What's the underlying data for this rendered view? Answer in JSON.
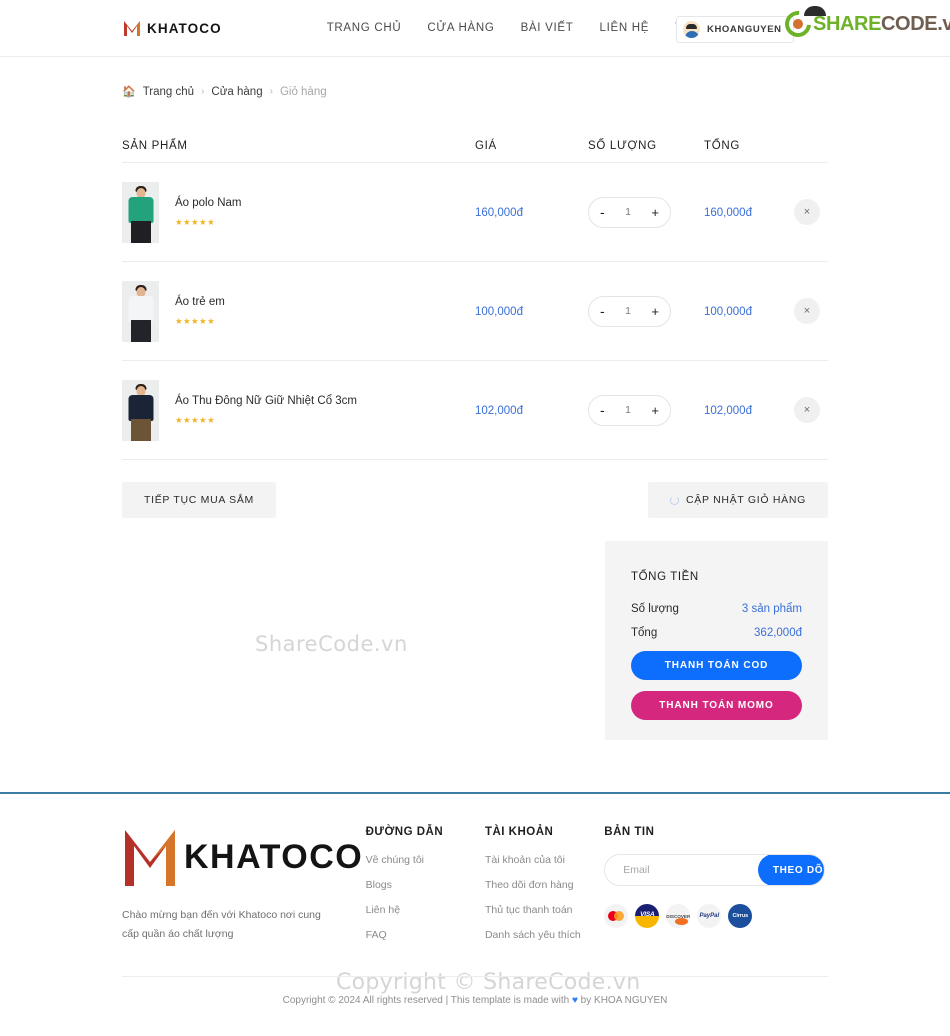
{
  "header": {
    "brand": "KHATOCO",
    "brand_mark_icon": "khatoco-m-monogram-icon",
    "nav": [
      {
        "label": "TRANG CHỦ"
      },
      {
        "label": "CỬA HÀNG"
      },
      {
        "label": "BÀI VIẾT"
      },
      {
        "label": "LIÊN HỆ"
      },
      {
        "label": "TRANG"
      }
    ],
    "user": {
      "name": "KHOANGUYEN",
      "avatar_icon": "user-avatar-icon"
    },
    "watermark_logo": {
      "share": "SHARE",
      "code": "CODE.vn",
      "icon": "sharecode-swirl-icon"
    }
  },
  "breadcrumb": {
    "home_icon": "home-icon",
    "items": [
      {
        "label": "Trang chủ",
        "current": false
      },
      {
        "label": "Cửa hàng",
        "current": false
      },
      {
        "label": "Giỏ hàng",
        "current": true
      }
    ],
    "separator": "›"
  },
  "cart": {
    "columns": {
      "product": "SẢN PHẨM",
      "price": "GIÁ",
      "quantity": "SỐ LƯỢNG",
      "total": "TỔNG"
    },
    "rows": [
      {
        "name": "Áo polo Nam",
        "stars": "★★★★★",
        "price": "160,000đ",
        "qty": "1",
        "total": "160,000đ",
        "thumb_body": "#22a37c",
        "thumb_legs": "#1f1f24"
      },
      {
        "name": "Áo trẻ em",
        "stars": "★★★★★",
        "price": "100,000đ",
        "qty": "1",
        "total": "100,000đ",
        "thumb_body": "#f2f3f4",
        "thumb_legs": "#23232a"
      },
      {
        "name": "Áo Thu Đông Nữ Giữ Nhiệt Cổ 3cm",
        "stars": "★★★★★",
        "price": "102,000đ",
        "qty": "1",
        "total": "102,000đ",
        "thumb_body": "#1b2436",
        "thumb_legs": "#6b5536"
      }
    ],
    "minus_label": "-",
    "plus_label": "+",
    "remove_label": "×",
    "continue_label": "TIẾP TỤC MUA SẮM",
    "update_label": "CẬP NHẬT GIỎ HÀNG"
  },
  "totals": {
    "title": "TỔNG TIỀN",
    "quantity_label": "Số lượng",
    "quantity_value": "3 sản phẩm",
    "total_label": "Tổng",
    "total_value": "362,000đ",
    "cod_label": "THANH TOÁN COD",
    "momo_label": "THANH TOÁN MOMO",
    "cod_color": "#0d6efd",
    "momo_color": "#d6277f"
  },
  "watermarks": {
    "center": "ShareCode.vn",
    "bottom": "Copyright © ShareCode.vn"
  },
  "footer": {
    "brand": "KHATOCO",
    "brand_mark_icon": "khatoco-m-monogram-icon",
    "description": "Chào mừng bạn đến với Khatoco nơi cung cấp quần áo chất lượng",
    "links_title": "ĐƯỜNG DẪN",
    "links": [
      {
        "label": "Về chúng tôi"
      },
      {
        "label": "Blogs"
      },
      {
        "label": "Liên hệ"
      },
      {
        "label": "FAQ"
      }
    ],
    "account_title": "TÀI KHOẢN",
    "account_links": [
      {
        "label": "Tài khoản của tôi"
      },
      {
        "label": "Theo dõi đơn hàng"
      },
      {
        "label": "Thủ tục thanh toán"
      },
      {
        "label": "Danh sách yêu thích"
      }
    ],
    "news_title": "BẢN TIN",
    "news_placeholder": "Email",
    "news_value": "",
    "news_button": "THEO DÕI",
    "payment_icons": [
      {
        "name": "mastercard-icon",
        "label": ""
      },
      {
        "name": "visa-icon",
        "label": "VISA"
      },
      {
        "name": "discover-icon",
        "label": "DISCOVER"
      },
      {
        "name": "paypal-icon",
        "label": "PayPal"
      },
      {
        "name": "cirrus-icon",
        "label": "Cirrus"
      }
    ],
    "copyright_pre": "Copyright © 2024 All rights reserved | This template is made with ",
    "copyright_heart": "♥",
    "copyright_post": " by KHOA NGUYEN"
  }
}
